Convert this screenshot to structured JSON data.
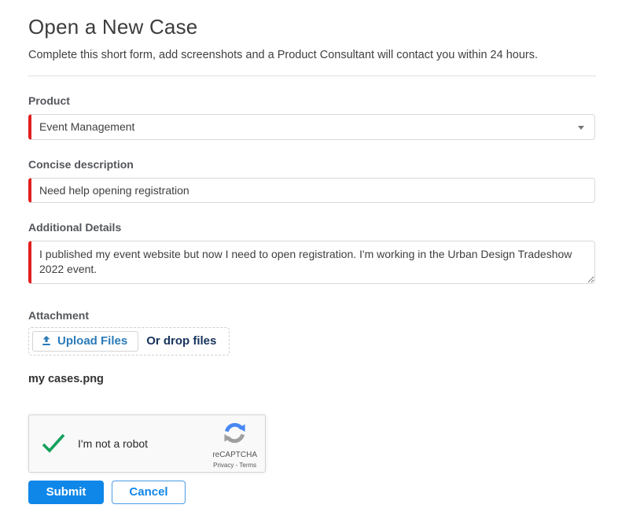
{
  "page": {
    "title": "Open a New Case",
    "subtitle": "Complete this short form, add screenshots and a Product Consultant will contact you within 24 hours."
  },
  "form": {
    "product": {
      "label": "Product",
      "value": "Event Management"
    },
    "description": {
      "label": "Concise description",
      "value": "Need help opening registration"
    },
    "details": {
      "label": "Additional Details",
      "value": "I published my event website but now I need to open registration. I'm working in the Urban Design Tradeshow 2022 event."
    },
    "attachment": {
      "label": "Attachment",
      "upload_button": "Upload Files",
      "drop_text": "Or drop files",
      "file_name": "my cases.png"
    }
  },
  "recaptcha": {
    "checkbox_label": "I'm not a robot",
    "brand": "reCAPTCHA",
    "privacy_link": "Privacy",
    "separator": "-",
    "terms_link": "Terms"
  },
  "actions": {
    "submit": "Submit",
    "cancel": "Cancel"
  },
  "colors": {
    "accent_blue": "#0f87e9",
    "required_red": "#e0201f",
    "check_green": "#14a05a",
    "upload_link_blue": "#2b7bb9",
    "drop_text_navy": "#16325c"
  }
}
